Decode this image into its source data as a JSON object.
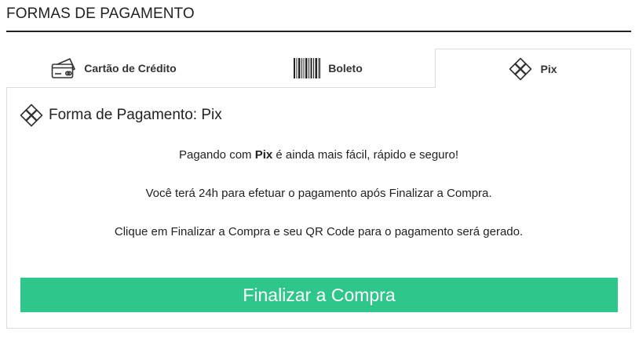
{
  "section": {
    "title": "FORMAS DE PAGAMENTO"
  },
  "tabs": [
    {
      "label": "Cartão de Crédito",
      "icon": "credit-card-icon",
      "active": false
    },
    {
      "label": "Boleto",
      "icon": "barcode-icon",
      "active": false
    },
    {
      "label": "Pix",
      "icon": "pix-icon",
      "active": true
    }
  ],
  "panel": {
    "heading": "Forma de Pagamento: Pix",
    "line1_before": "Pagando com ",
    "line1_bold": "Pix",
    "line1_after": " é ainda mais fácil, rápido e seguro!",
    "line2": "Você terá 24h para efetuar o pagamento após Finalizar a Compra.",
    "line3": "Clique em Finalizar a Compra e seu QR Code para o pagamento será gerado.",
    "button_label": "Finalizar a Compra"
  },
  "colors": {
    "accent": "#2ec68b",
    "text": "#222222",
    "border": "#dcdcdc"
  }
}
